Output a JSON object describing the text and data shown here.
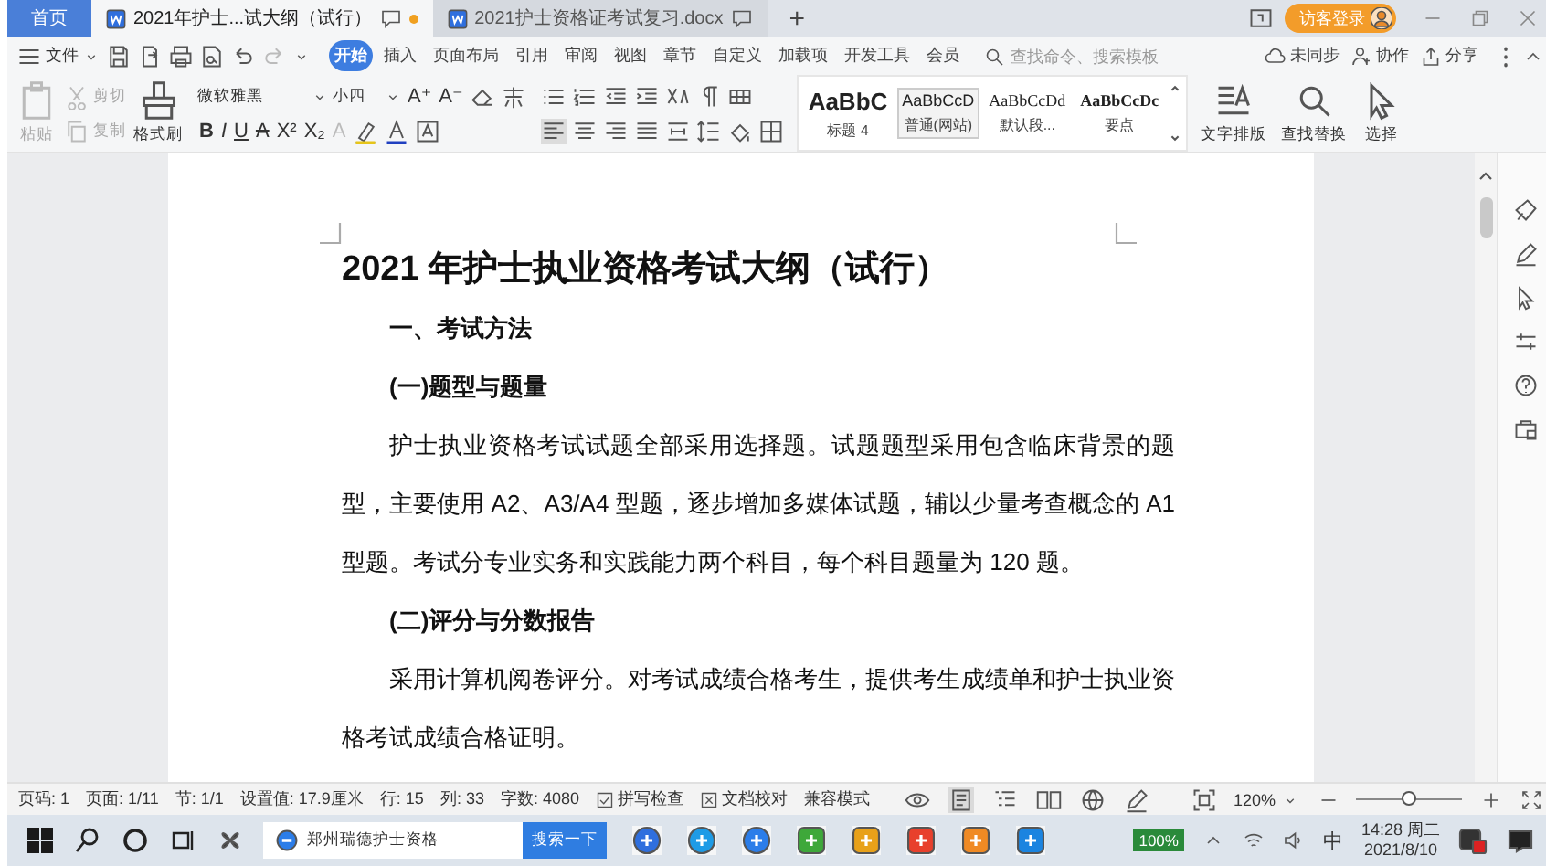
{
  "tab_bar": {
    "home_tab": "首页",
    "doc_tabs": [
      {
        "title": "2021年护士...试大纲（试行）",
        "selected": true,
        "modified": true
      },
      {
        "title": "2021护士资格证考试复习.docx",
        "selected": false,
        "modified": false
      }
    ],
    "new_tab": "+",
    "login_button": "访客登录"
  },
  "menu_bar": {
    "file_menu": "文件",
    "ribbon_tabs": [
      {
        "label": "开始",
        "selected": true
      },
      {
        "label": "插入",
        "selected": false
      },
      {
        "label": "页面布局",
        "selected": false
      },
      {
        "label": "引用",
        "selected": false
      },
      {
        "label": "审阅",
        "selected": false
      },
      {
        "label": "视图",
        "selected": false
      },
      {
        "label": "章节",
        "selected": false
      },
      {
        "label": "自定义",
        "selected": false
      },
      {
        "label": "加载项",
        "selected": false
      },
      {
        "label": "开发工具",
        "selected": false
      },
      {
        "label": "会员",
        "selected": false
      }
    ],
    "search": {
      "placeholder": "查找命令、搜索模板"
    },
    "actions": [
      {
        "label": "未同步",
        "kind": "sync"
      },
      {
        "label": "协作",
        "kind": "collab"
      },
      {
        "label": "分享",
        "kind": "share"
      }
    ]
  },
  "ribbon": {
    "paste": "粘贴",
    "cut": "剪切",
    "copy": "复制",
    "format_painter": "格式刷",
    "font_name": "微软雅黑",
    "font_size": "小四",
    "font_row_1": [
      "A⁺",
      "A⁻"
    ],
    "font_row_2": [
      {
        "glyph": "B",
        "kind": "bold"
      },
      {
        "glyph": "I",
        "kind": "italic"
      },
      {
        "glyph": "U",
        "kind": "underline"
      },
      {
        "glyph": "A",
        "kind": "strike"
      },
      {
        "glyph": "X²",
        "kind": "plain"
      },
      {
        "glyph": "X₂",
        "kind": "plain"
      },
      {
        "glyph": "A",
        "kind": "faded"
      }
    ],
    "styles": [
      {
        "preview": "AaBbC",
        "label": "标题 4",
        "kind": "heading",
        "selected": false
      },
      {
        "preview": "AaBbCcD",
        "label": "普通(网站)",
        "kind": "normal",
        "selected": true
      },
      {
        "preview": "AaBbCcDd",
        "label": "默认段...",
        "kind": "serif",
        "selected": false
      },
      {
        "preview": "AaBbCcDc",
        "label": "要点",
        "kind": "strong",
        "selected": false
      }
    ],
    "tools": [
      {
        "label": "文字排版",
        "kind": "layout"
      },
      {
        "label": "查找替换",
        "kind": "find"
      },
      {
        "label": "选择",
        "kind": "select"
      }
    ]
  },
  "document": {
    "title": "2021 年护士执业资格考试大纲（试行）",
    "blocks": [
      {
        "kind": "heading",
        "text": "一、考试方法"
      },
      {
        "kind": "heading",
        "text": "(一)题型与题量"
      },
      {
        "kind": "paragraph",
        "text": "护士执业资格考试试题全部采用选择题。试题题型采用包含临床背景的题型，主要使用 A2、A3/A4 型题，逐步增加多媒体试题，辅以少量考查概念的 A1 型题。考试分专业实务和实践能力两个科目，每个科目题量为 120 题。"
      },
      {
        "kind": "heading",
        "text": "(二)评分与分数报告"
      },
      {
        "kind": "paragraph",
        "text": "采用计算机阅卷评分。对考试成绩合格考生，提供考生成绩单和护士执业资格考试成绩合格证明。"
      }
    ]
  },
  "status_bar": {
    "items": [
      {
        "text": "页码: 1",
        "kind": "text"
      },
      {
        "text": "页面: 1/11",
        "kind": "text"
      },
      {
        "text": "节: 1/1",
        "kind": "text"
      },
      {
        "text": "设置值: 17.9厘米",
        "kind": "text"
      },
      {
        "text": "行: 15",
        "kind": "text"
      },
      {
        "text": "列: 33",
        "kind": "text"
      },
      {
        "text": "字数: 4080",
        "kind": "text"
      },
      {
        "text": "拼写检查",
        "kind": "check"
      },
      {
        "text": "文档校对",
        "kind": "proof"
      },
      {
        "text": "兼容模式",
        "kind": "text"
      }
    ],
    "views": [
      {
        "kind": "page",
        "selected": true
      },
      {
        "kind": "outline",
        "selected": false
      },
      {
        "kind": "read",
        "selected": false
      },
      {
        "kind": "web",
        "selected": false
      },
      {
        "kind": "pen",
        "selected": false
      }
    ],
    "zoom": "120%",
    "zoom_slider": {
      "level": 0.5
    }
  },
  "taskbar": {
    "search_box": "郑州瑞德护士资格",
    "search_button": "搜索一下",
    "battery": "100%",
    "ime": "中",
    "time": "14:28 周二",
    "date": "2021/8/10"
  }
}
